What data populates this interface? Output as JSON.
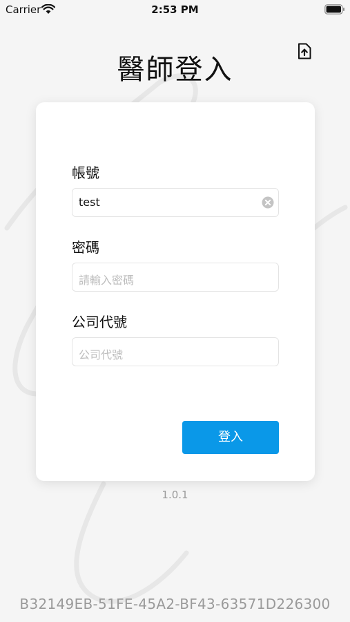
{
  "status_bar": {
    "carrier": "Carrier",
    "time": "2:53 PM",
    "wifi_icon": "wifi-icon",
    "battery_icon": "battery-icon"
  },
  "header": {
    "title": "醫師登入",
    "upload_icon": "file-upload-icon"
  },
  "form": {
    "account": {
      "label": "帳號",
      "value": "test",
      "clear_icon": "clear-icon"
    },
    "password": {
      "label": "密碼",
      "placeholder": "請輸入密碼"
    },
    "company_code": {
      "label": "公司代號",
      "placeholder": "公司代號"
    },
    "login_button_label": "登入"
  },
  "footer": {
    "version": "1.0.1",
    "device_id": "B32149EB-51FE-45A2-BF43-63571D226300"
  },
  "colors": {
    "accent": "#0a98e8",
    "background": "#f5f5f5",
    "card": "#ffffff",
    "muted_text": "#9a9a9a",
    "placeholder": "#bdbdbd"
  }
}
